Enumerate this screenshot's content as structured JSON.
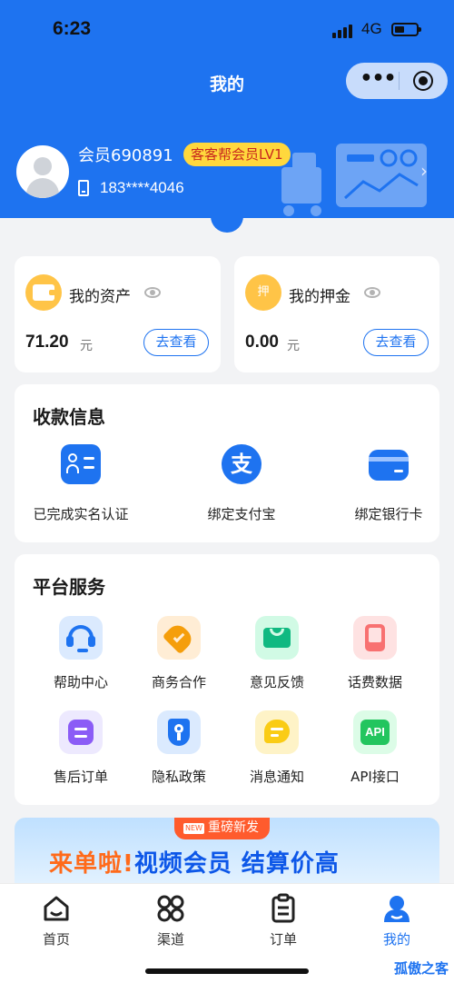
{
  "status_bar": {
    "time": "6:23",
    "network": "4G"
  },
  "nav": {
    "title": "我的",
    "more_glyph": "•••"
  },
  "profile": {
    "username": "会员690891",
    "level_badge": "客客帮会员LV1",
    "phone": "183****4046",
    "chevron": "›"
  },
  "assets": {
    "title": "我的资产",
    "amount": "71.20",
    "unit": "元",
    "button": "去查看"
  },
  "deposit": {
    "title": "我的押金",
    "icon_char": "押",
    "amount": "0.00",
    "unit": "元",
    "button": "去查看"
  },
  "payment_info": {
    "title": "收款信息",
    "items": [
      {
        "label": "已完成实名认证",
        "icon": "id-card-icon"
      },
      {
        "label": "绑定支付宝",
        "icon": "alipay-icon",
        "glyph": "支"
      },
      {
        "label": "绑定银行卡",
        "icon": "bank-card-icon"
      }
    ]
  },
  "services": {
    "title": "平台服务",
    "items": [
      {
        "label": "帮助中心",
        "icon": "headset-icon",
        "bg": "#dbeafe",
        "fg": "#1e73f0"
      },
      {
        "label": "商务合作",
        "icon": "handshake-icon",
        "bg": "#ffedd5",
        "fg": "#f59e0b"
      },
      {
        "label": "意见反馈",
        "icon": "mail-icon",
        "bg": "#d1fae5",
        "fg": "#10b981"
      },
      {
        "label": "话费数据",
        "icon": "phone-bill-icon",
        "bg": "#fee2e2",
        "fg": "#f87171"
      },
      {
        "label": "售后订单",
        "icon": "order-icon",
        "bg": "#ede9fe",
        "fg": "#8b5cf6"
      },
      {
        "label": "隐私政策",
        "icon": "privacy-shield-icon",
        "bg": "#dbeafe",
        "fg": "#1e73f0"
      },
      {
        "label": "消息通知",
        "icon": "message-icon",
        "bg": "#fef3c7",
        "fg": "#facc15"
      },
      {
        "label": "API接口",
        "icon": "api-icon",
        "bg": "#dcfce7",
        "fg": "#22c55e",
        "glyph": "API"
      }
    ]
  },
  "banner": {
    "tag_new": "NEW",
    "tag": "重磅新发",
    "headline_1": "来单啦!",
    "headline_2": "视频会员 结算价高"
  },
  "tabbar": {
    "items": [
      {
        "label": "首页",
        "icon": "home-icon"
      },
      {
        "label": "渠道",
        "icon": "channels-icon"
      },
      {
        "label": "订单",
        "icon": "orders-icon"
      },
      {
        "label": "我的",
        "icon": "profile-icon",
        "active": true
      }
    ]
  },
  "watermark": "孤傲之客",
  "colors": {
    "primary": "#1e73f0",
    "badge_bg": "#ffd83d",
    "badge_text": "#c8281e",
    "coin": "#ffc447",
    "banner_accent": "#ff6a1a"
  }
}
